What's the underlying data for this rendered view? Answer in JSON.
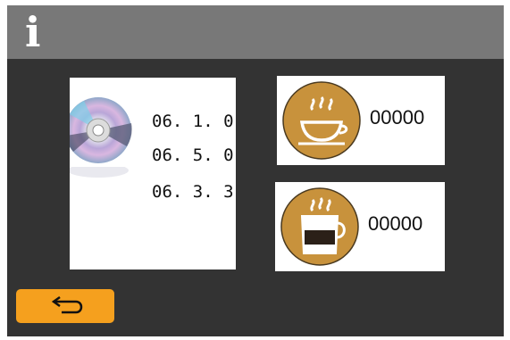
{
  "header": {
    "icon": "info-icon"
  },
  "versions": {
    "icon": "disc-icon",
    "values": [
      "06. 1. 0",
      "06. 5. 0",
      "06. 3. 3"
    ]
  },
  "counters": [
    {
      "icon": "espresso-cup-icon",
      "value": "00000"
    },
    {
      "icon": "coffee-cup-icon",
      "value": "00000"
    }
  ],
  "back_button": {
    "icon": "return-arrow-icon"
  },
  "colors": {
    "background": "#333333",
    "header": "#787878",
    "accent": "#f5a01e",
    "cup_badge": "#c8923c"
  }
}
